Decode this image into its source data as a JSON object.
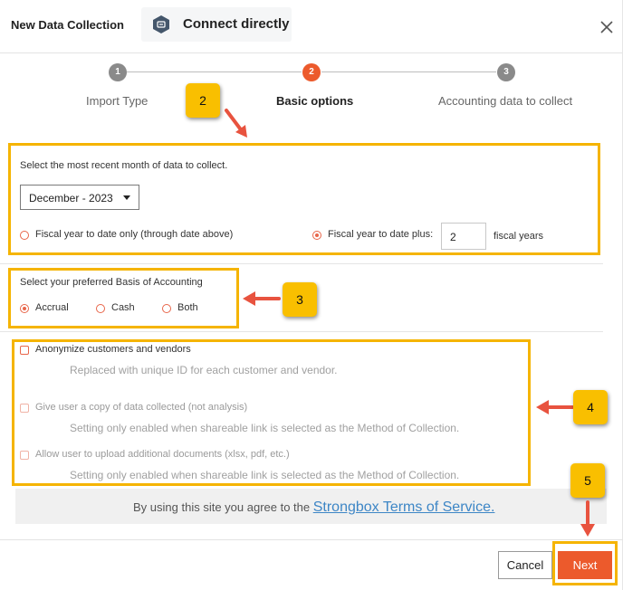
{
  "dialog": {
    "title": "New Data Collection",
    "connect_label": "Connect directly",
    "close_icon": "close-icon"
  },
  "stepper": {
    "steps": [
      {
        "number": "1",
        "label": "Import Type",
        "state": "inactive"
      },
      {
        "number": "2",
        "label": "Basic options",
        "state": "active"
      },
      {
        "number": "3",
        "label": "Accounting data to collect",
        "state": "inactive"
      }
    ]
  },
  "callouts": [
    "2",
    "3",
    "4",
    "5"
  ],
  "month_section": {
    "prompt": "Select the most recent month of data to collect.",
    "selected_month": "December - 2023",
    "option_ytd_only": "Fiscal year to date only (through date above)",
    "option_ytd_plus": "Fiscal year to date plus:",
    "fiscal_years_value": "2",
    "fiscal_years_suffix": "fiscal years"
  },
  "basis_section": {
    "prompt": "Select your preferred Basis of Accounting",
    "options": [
      "Accrual",
      "Cash",
      "Both"
    ],
    "selected": "Accrual"
  },
  "extras_section": {
    "anonymize_label": "Anonymize customers and vendors",
    "anonymize_desc": "Replaced with unique ID for each customer and vendor.",
    "copy_label": "Give user a copy of data collected (not analysis)",
    "copy_desc": "Setting only enabled when shareable link is selected as the Method of Collection.",
    "upload_label": "Allow user to upload additional documents (xlsx, pdf, etc.)",
    "upload_desc": "Setting only enabled when shareable link is selected as the Method of Collection."
  },
  "terms": {
    "prefix": "By using this site you agree to the ",
    "link": "Strongbox Terms of Service."
  },
  "footer": {
    "cancel_label": "Cancel",
    "next_label": "Next"
  },
  "colors": {
    "accent": "#ec5a2c",
    "step_inactive": "#8a8a8a",
    "callout": "#f9bf00",
    "highlight_border": "#f5b400",
    "arrow": "#e8533f",
    "link": "#3d86c6"
  }
}
